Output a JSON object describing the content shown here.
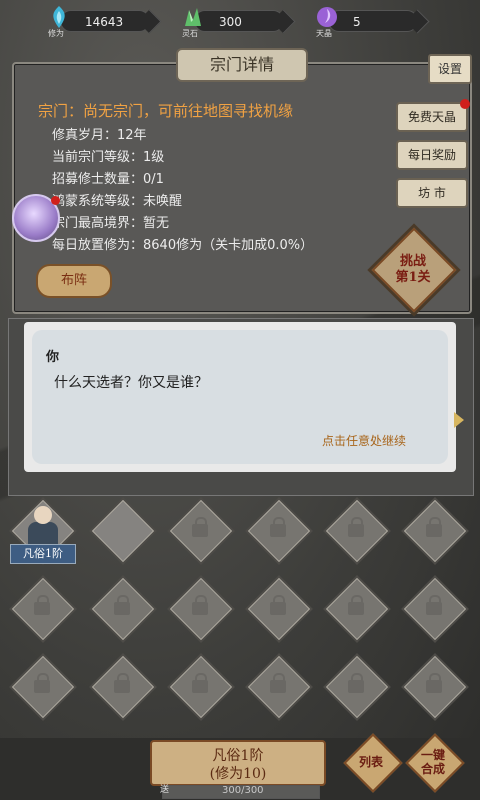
{
  "resources": [
    {
      "value": "14643",
      "caption": "修为",
      "icon": "cultivation-gem-icon",
      "color": "#3fb6d8"
    },
    {
      "value": "300",
      "caption": "灵石",
      "icon": "spirit-stone-icon",
      "color": "#5fbf6a"
    },
    {
      "value": "5",
      "caption": "天晶",
      "icon": "heaven-crystal-icon",
      "color": "#9a62d6"
    }
  ],
  "panel": {
    "title": "宗门详情",
    "settings_label": "设置",
    "sect_line": "宗门：尚无宗门，可前往地图寻找机缘",
    "info": [
      "修真岁月：12年",
      "当前宗门等级：1级",
      "招募修士数量：0/1",
      "鸿蒙系统等级：未唤醒",
      "宗门最高境界：暂无",
      "每日放置修为：8640修为（关卡加成0.0%）"
    ],
    "side_buttons": [
      "免费天晶",
      "每日奖励",
      "坊 市"
    ],
    "formation_label": "布阵",
    "challenge_label_1": "挑战",
    "challenge_label_2": "第1关"
  },
  "dialog": {
    "speaker": "你",
    "text": "什么天选者？你又是谁？",
    "continue_hint": "点击任意处继续"
  },
  "grid": {
    "hero_label": "凡俗1阶"
  },
  "bottom": {
    "summon_line1": "凡俗1阶",
    "summon_line2": "(修为10)",
    "list_label": "列表",
    "merge_label_1": "一键",
    "merge_label_2": "合成",
    "xp_text": "300/300",
    "xp_prefix": "送",
    "xp_fraction": 1.0
  }
}
